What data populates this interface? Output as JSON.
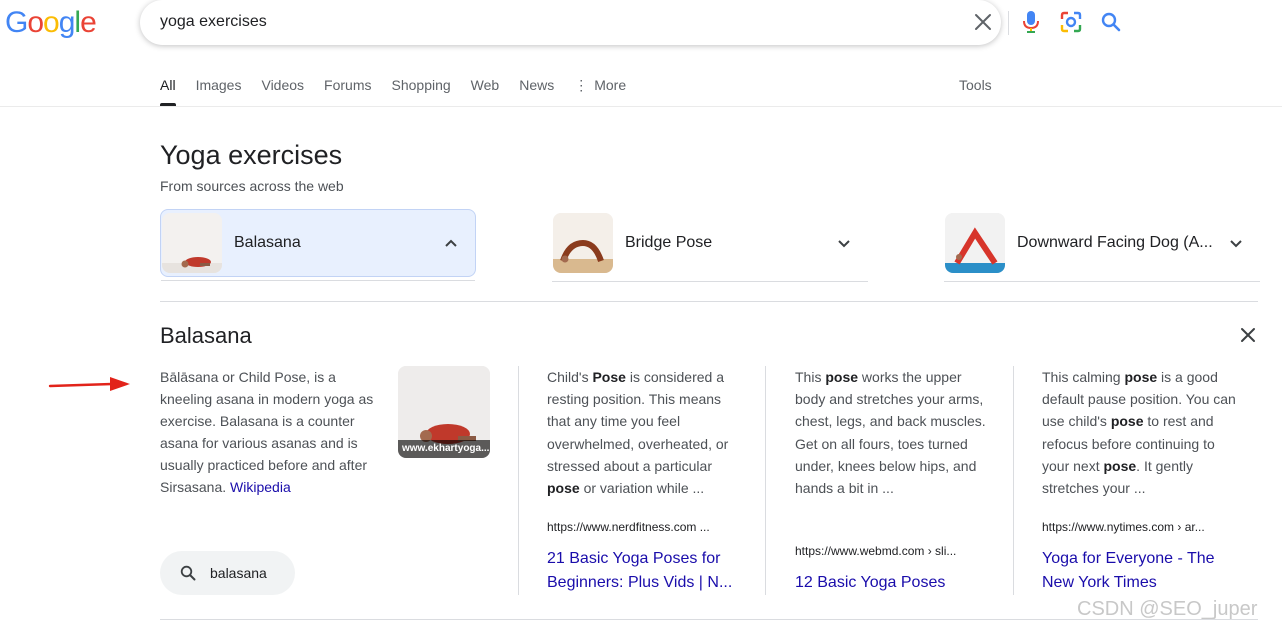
{
  "logo": {
    "letters": [
      "G",
      "o",
      "o",
      "g",
      "l",
      "e"
    ],
    "colors": [
      "#4285F4",
      "#EA4335",
      "#FBBC05",
      "#4285F4",
      "#34A853",
      "#EA4335"
    ]
  },
  "search": {
    "query": "yoga exercises",
    "icons": [
      "close-icon",
      "microphone-icon",
      "google-lens-icon",
      "search-icon"
    ]
  },
  "tabs": [
    {
      "label": "All",
      "active": true
    },
    {
      "label": "Images"
    },
    {
      "label": "Videos"
    },
    {
      "label": "Forums"
    },
    {
      "label": "Shopping"
    },
    {
      "label": "Web"
    },
    {
      "label": "News"
    },
    {
      "label": "More"
    }
  ],
  "tools_label": "Tools",
  "heading": {
    "title": "Yoga exercises",
    "subtitle": "From sources across the web"
  },
  "chips": [
    {
      "label": "Balasana",
      "expanded": true
    },
    {
      "label": "Bridge Pose",
      "expanded": false
    },
    {
      "label": "Downward Facing Dog (A...",
      "expanded": false
    }
  ],
  "panel": {
    "title": "Balasana",
    "description_text": "Bālāsana or Child Pose, is a kneeling asana in modern yoga as exercise. Balasana is a counter asana for various asanas and is usually practiced before and after Sirsasana.",
    "description_link": "Wikipedia",
    "image_caption": "www.ekhartyoga...",
    "query_chip": "balasana"
  },
  "results": [
    {
      "snippet_parts": [
        "Child's ",
        "Pose",
        " is considered a resting position. This means that any time you feel overwhelmed, overheated, or stressed about a particular ",
        "pose",
        " or variation while ..."
      ],
      "url": "https://www.nerdfitness.com ...",
      "title": "21 Basic Yoga Poses for Beginners: Plus Vids | N..."
    },
    {
      "snippet_parts": [
        "This ",
        "pose",
        " works the upper body and stretches your arms, chest, legs, and back muscles. Get on all fours, toes turned under, knees below hips, and hands a bit in ..."
      ],
      "url": "https://www.webmd.com › sli...",
      "title": "12 Basic Yoga Poses"
    },
    {
      "snippet_parts": [
        "This calming ",
        "pose",
        " is a good default pause position. You can use child's ",
        "pose",
        " to rest and refocus before continuing to your next ",
        "pose",
        ". It gently stretches your ..."
      ],
      "url": "https://www.nytimes.com › ar...",
      "title": "Yoga for Everyone - The New York Times"
    }
  ],
  "watermark": "CSDN @SEO_juper",
  "accent_colors": {
    "link": "#1a0dab",
    "selected_chip": "#e8f0fe",
    "annotation_arrow": "#e2231a"
  }
}
